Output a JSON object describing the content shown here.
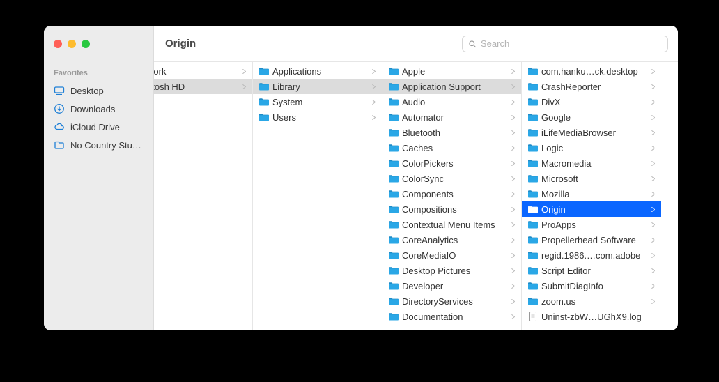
{
  "window": {
    "title": "Origin",
    "search_placeholder": "Search"
  },
  "sidebar": {
    "heading": "Favorites",
    "items": [
      {
        "label": "Desktop",
        "icon": "desktop"
      },
      {
        "label": "Downloads",
        "icon": "download"
      },
      {
        "label": "iCloud Drive",
        "icon": "cloud"
      },
      {
        "label": "No Country Studio",
        "icon": "folder"
      }
    ]
  },
  "columns": [
    {
      "width_key": "c0",
      "items": [
        {
          "label": "work",
          "type": "folder",
          "has_children": true,
          "selected": false,
          "name": "item-work"
        },
        {
          "label": "ntosh HD",
          "type": "folder",
          "has_children": true,
          "selected": "muted",
          "name": "item-macintosh-hd"
        }
      ]
    },
    {
      "width_key": "c1",
      "items": [
        {
          "label": "Applications",
          "type": "folder",
          "has_children": true,
          "selected": false,
          "name": "item-applications"
        },
        {
          "label": "Library",
          "type": "folder",
          "has_children": true,
          "selected": "muted",
          "name": "item-library"
        },
        {
          "label": "System",
          "type": "folder",
          "has_children": true,
          "selected": false,
          "name": "item-system"
        },
        {
          "label": "Users",
          "type": "folder",
          "has_children": true,
          "selected": false,
          "name": "item-users"
        }
      ]
    },
    {
      "width_key": "c2",
      "items": [
        {
          "label": "Apple",
          "type": "folder",
          "has_children": true,
          "selected": false,
          "name": "item-apple"
        },
        {
          "label": "Application Support",
          "type": "folder",
          "has_children": true,
          "selected": "muted",
          "name": "item-application-support"
        },
        {
          "label": "Audio",
          "type": "folder",
          "has_children": true,
          "selected": false,
          "name": "item-audio"
        },
        {
          "label": "Automator",
          "type": "folder",
          "has_children": true,
          "selected": false,
          "name": "item-automator"
        },
        {
          "label": "Bluetooth",
          "type": "folder",
          "has_children": true,
          "selected": false,
          "name": "item-bluetooth"
        },
        {
          "label": "Caches",
          "type": "folder",
          "has_children": true,
          "selected": false,
          "name": "item-caches"
        },
        {
          "label": "ColorPickers",
          "type": "folder",
          "has_children": true,
          "selected": false,
          "name": "item-colorpickers"
        },
        {
          "label": "ColorSync",
          "type": "folder",
          "has_children": true,
          "selected": false,
          "name": "item-colorsync"
        },
        {
          "label": "Components",
          "type": "folder",
          "has_children": true,
          "selected": false,
          "name": "item-components"
        },
        {
          "label": "Compositions",
          "type": "folder",
          "has_children": true,
          "selected": false,
          "name": "item-compositions"
        },
        {
          "label": "Contextual Menu Items",
          "type": "folder",
          "has_children": true,
          "selected": false,
          "name": "item-contextual-menu-items"
        },
        {
          "label": "CoreAnalytics",
          "type": "folder",
          "has_children": true,
          "selected": false,
          "name": "item-coreanalytics"
        },
        {
          "label": "CoreMediaIO",
          "type": "folder",
          "has_children": true,
          "selected": false,
          "name": "item-coremediaio"
        },
        {
          "label": "Desktop Pictures",
          "type": "folder",
          "has_children": true,
          "selected": false,
          "name": "item-desktop-pictures"
        },
        {
          "label": "Developer",
          "type": "folder",
          "has_children": true,
          "selected": false,
          "name": "item-developer"
        },
        {
          "label": "DirectoryServices",
          "type": "folder",
          "has_children": true,
          "selected": false,
          "name": "item-directoryservices"
        },
        {
          "label": "Documentation",
          "type": "folder",
          "has_children": true,
          "selected": false,
          "name": "item-documentation"
        }
      ]
    },
    {
      "width_key": "c3",
      "items": [
        {
          "label": "com.hanku…ck.desktop",
          "type": "folder",
          "has_children": true,
          "selected": false,
          "name": "item-com-hanku"
        },
        {
          "label": "CrashReporter",
          "type": "folder",
          "has_children": true,
          "selected": false,
          "name": "item-crashreporter"
        },
        {
          "label": "DivX",
          "type": "folder",
          "has_children": true,
          "selected": false,
          "name": "item-divx"
        },
        {
          "label": "Google",
          "type": "folder",
          "has_children": true,
          "selected": false,
          "name": "item-google"
        },
        {
          "label": "iLifeMediaBrowser",
          "type": "folder",
          "has_children": true,
          "selected": false,
          "name": "item-ilifemediabrowser"
        },
        {
          "label": "Logic",
          "type": "folder",
          "has_children": true,
          "selected": false,
          "name": "item-logic"
        },
        {
          "label": "Macromedia",
          "type": "folder",
          "has_children": true,
          "selected": false,
          "name": "item-macromedia"
        },
        {
          "label": "Microsoft",
          "type": "folder",
          "has_children": true,
          "selected": false,
          "name": "item-microsoft"
        },
        {
          "label": "Mozilla",
          "type": "folder",
          "has_children": true,
          "selected": false,
          "name": "item-mozilla"
        },
        {
          "label": "Origin",
          "type": "folder",
          "has_children": true,
          "selected": "active",
          "name": "item-origin"
        },
        {
          "label": "ProApps",
          "type": "folder",
          "has_children": true,
          "selected": false,
          "name": "item-proapps"
        },
        {
          "label": "Propellerhead Software",
          "type": "folder",
          "has_children": true,
          "selected": false,
          "name": "item-propellerhead-software"
        },
        {
          "label": "regid.1986.…com.adobe",
          "type": "folder",
          "has_children": true,
          "selected": false,
          "name": "item-regid-adobe"
        },
        {
          "label": "Script Editor",
          "type": "folder",
          "has_children": true,
          "selected": false,
          "name": "item-script-editor"
        },
        {
          "label": "SubmitDiagInfo",
          "type": "folder",
          "has_children": true,
          "selected": false,
          "name": "item-submitdiaginfo"
        },
        {
          "label": "zoom.us",
          "type": "folder",
          "has_children": true,
          "selected": false,
          "name": "item-zoom-us"
        },
        {
          "label": "Uninst-zbW…UGhX9.log",
          "type": "file",
          "has_children": false,
          "selected": false,
          "name": "item-uninst-log"
        }
      ]
    }
  ]
}
